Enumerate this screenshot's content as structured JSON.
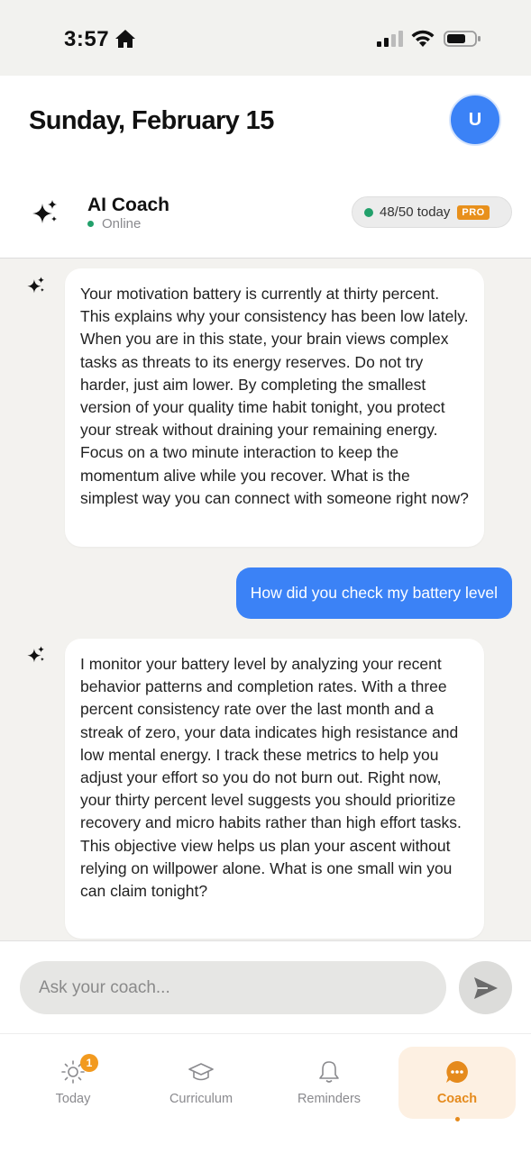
{
  "status_bar": {
    "time": "3:57"
  },
  "header": {
    "date": "Sunday, February 15",
    "avatar_initial": "U"
  },
  "coach": {
    "name": "AI Coach",
    "status": "Online",
    "usage": "48/50 today",
    "badge": "PRO"
  },
  "messages": [
    {
      "role": "assistant",
      "text": "Your motivation battery is currently at thirty percent. This explains why your consistency has been low lately. When you are in this state, your brain views complex tasks as threats to its energy reserves. Do not try harder, just aim lower. By completing the smallest version of your quality time habit tonight, you protect your streak without draining your remaining energy. Focus on a two minute interaction to keep the momentum alive while you recover. What is the simplest way you can connect with someone right now?"
    },
    {
      "role": "user",
      "text": "How did you check my battery level"
    },
    {
      "role": "assistant",
      "text": "I monitor your battery level by analyzing your recent behavior patterns and completion rates. With a three percent consistency rate over the last month and a streak of zero, your data indicates high resistance and low mental energy. I track these metrics to help you adjust your effort so you do not burn out. Right now, your thirty percent level suggests you should prioritize recovery and micro habits rather than high effort tasks. This objective view helps us plan your ascent without relying on willpower alone. What is one small win you can claim tonight?"
    }
  ],
  "composer": {
    "placeholder": "Ask your coach..."
  },
  "tabs": [
    {
      "label": "Today",
      "badge": "1",
      "icon": "sun-icon"
    },
    {
      "label": "Curriculum",
      "icon": "graduation-cap-icon"
    },
    {
      "label": "Reminders",
      "icon": "bell-icon"
    },
    {
      "label": "Coach",
      "icon": "chat-bubble-icon",
      "active": true
    }
  ],
  "colors": {
    "accent": "#3b82f6",
    "brand_orange": "#e58a1c",
    "online": "#22a06b"
  }
}
